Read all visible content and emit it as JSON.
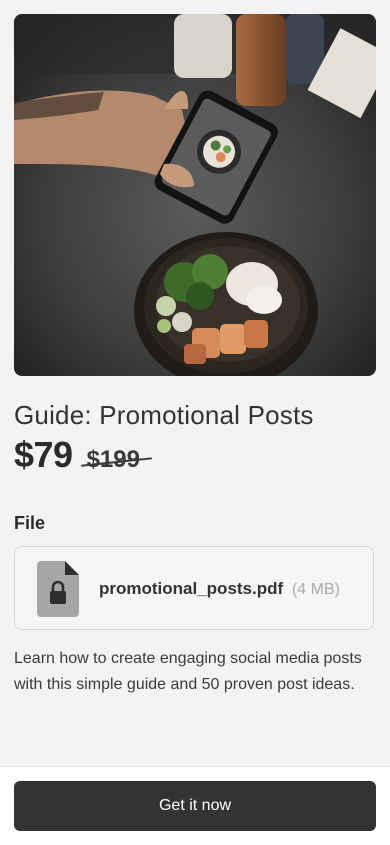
{
  "product": {
    "title": "Guide: Promotional Posts",
    "price": "$79",
    "original_price": "$199"
  },
  "file_section": {
    "heading": "File",
    "file_name": "promotional_posts.pdf",
    "file_size": "(4 MB)",
    "icon": "locked-file-icon"
  },
  "description": "Learn how to create engaging social media posts with this simple guide and 50 proven post ideas.",
  "cta": {
    "label": "Get it now"
  },
  "colors": {
    "background": "#f3f3f3",
    "button": "#333333",
    "button_text": "#ffffff"
  }
}
